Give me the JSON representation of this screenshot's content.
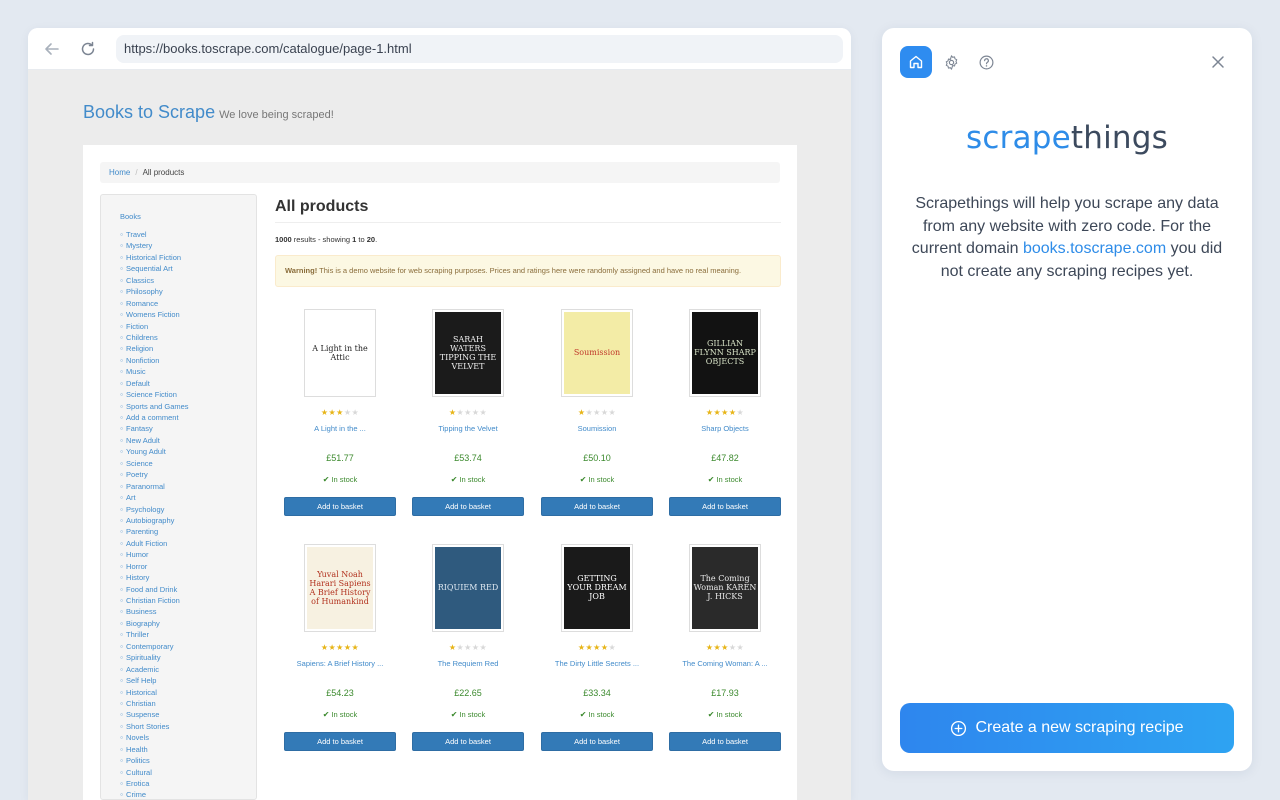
{
  "browser": {
    "url": "https://books.toscrape.com/catalogue/page-1.html"
  },
  "site": {
    "brand": "Books to Scrape",
    "tagline": "We love being scraped!",
    "breadcrumb": {
      "home": "Home",
      "sep": "/",
      "current": "All products"
    },
    "sidebar_root": "Books",
    "categories": [
      "Travel",
      "Mystery",
      "Historical Fiction",
      "Sequential Art",
      "Classics",
      "Philosophy",
      "Romance",
      "Womens Fiction",
      "Fiction",
      "Childrens",
      "Religion",
      "Nonfiction",
      "Music",
      "Default",
      "Science Fiction",
      "Sports and Games",
      "Add a comment",
      "Fantasy",
      "New Adult",
      "Young Adult",
      "Science",
      "Poetry",
      "Paranormal",
      "Art",
      "Psychology",
      "Autobiography",
      "Parenting",
      "Adult Fiction",
      "Humor",
      "Horror",
      "History",
      "Food and Drink",
      "Christian Fiction",
      "Business",
      "Biography",
      "Thriller",
      "Contemporary",
      "Spirituality",
      "Academic",
      "Self Help",
      "Historical",
      "Christian",
      "Suspense",
      "Short Stories",
      "Novels",
      "Health",
      "Politics",
      "Cultural",
      "Erotica",
      "Crime"
    ],
    "heading": "All products",
    "results": {
      "count": "1000",
      "text1": " results - showing ",
      "from": "1",
      "text2": " to ",
      "to": "20",
      "text3": "."
    },
    "warning": {
      "label": "Warning!",
      "text": " This is a demo website for web scraping purposes. Prices and ratings here were randomly assigned and have no real meaning."
    },
    "stock_label": "In stock",
    "basket_label": "Add to basket",
    "products": [
      {
        "title": "A Light in the ...",
        "price": "£51.77",
        "rating": 3,
        "cover_text": "A Light in the Attic",
        "cover_bg": "#ffffff",
        "cover_fg": "#222222"
      },
      {
        "title": "Tipping the Velvet",
        "price": "£53.74",
        "rating": 1,
        "cover_text": "SARAH WATERS TIPPING THE VELVET",
        "cover_bg": "#1b1b1b",
        "cover_fg": "#f0f0f0"
      },
      {
        "title": "Soumission",
        "price": "£50.10",
        "rating": 1,
        "cover_text": "Soumission",
        "cover_bg": "#f3eca6",
        "cover_fg": "#c0392b"
      },
      {
        "title": "Sharp Objects",
        "price": "£47.82",
        "rating": 4,
        "cover_text": "GILLIAN FLYNN SHARP OBJECTS",
        "cover_bg": "#121212",
        "cover_fg": "#d9e4c8"
      },
      {
        "title": "Sapiens: A Brief History ...",
        "price": "£54.23",
        "rating": 5,
        "cover_text": "Yuval Noah Harari Sapiens A Brief History of Humankind",
        "cover_bg": "#f7f1e1",
        "cover_fg": "#b2321f"
      },
      {
        "title": "The Requiem Red",
        "price": "£22.65",
        "rating": 1,
        "cover_text": "RIQUIEM RED",
        "cover_bg": "#2f5a7e",
        "cover_fg": "#dfe9f2"
      },
      {
        "title": "The Dirty Little Secrets ...",
        "price": "£33.34",
        "rating": 4,
        "cover_text": "GETTING YOUR DREAM JOB",
        "cover_bg": "#1a1a1a",
        "cover_fg": "#ffffff"
      },
      {
        "title": "The Coming Woman: A ...",
        "price": "£17.93",
        "rating": 3,
        "cover_text": "The Coming Woman KAREN J. HICKS",
        "cover_bg": "#2a2a2a",
        "cover_fg": "#eaeaea"
      }
    ]
  },
  "panel": {
    "logo_part1": "scrape",
    "logo_part2": "things",
    "intro_before": "Scrapethings will help you scrape any data from any website with zero code. For the current domain ",
    "intro_domain": "books.toscrape.com",
    "intro_after": " you did not create any scraping recipes yet.",
    "create_label": "Create a new scraping recipe"
  },
  "colors": {
    "accent": "#2e8ce8",
    "site_link": "#428bca",
    "price_green": "#3c8a2e",
    "star": "#e7b416"
  },
  "icons": {
    "back": "arrow-left-icon",
    "reload": "reload-icon",
    "home": "home-icon",
    "settings": "gear-icon",
    "help": "help-circle-icon",
    "close": "close-icon",
    "create": "plus-circle-icon"
  }
}
